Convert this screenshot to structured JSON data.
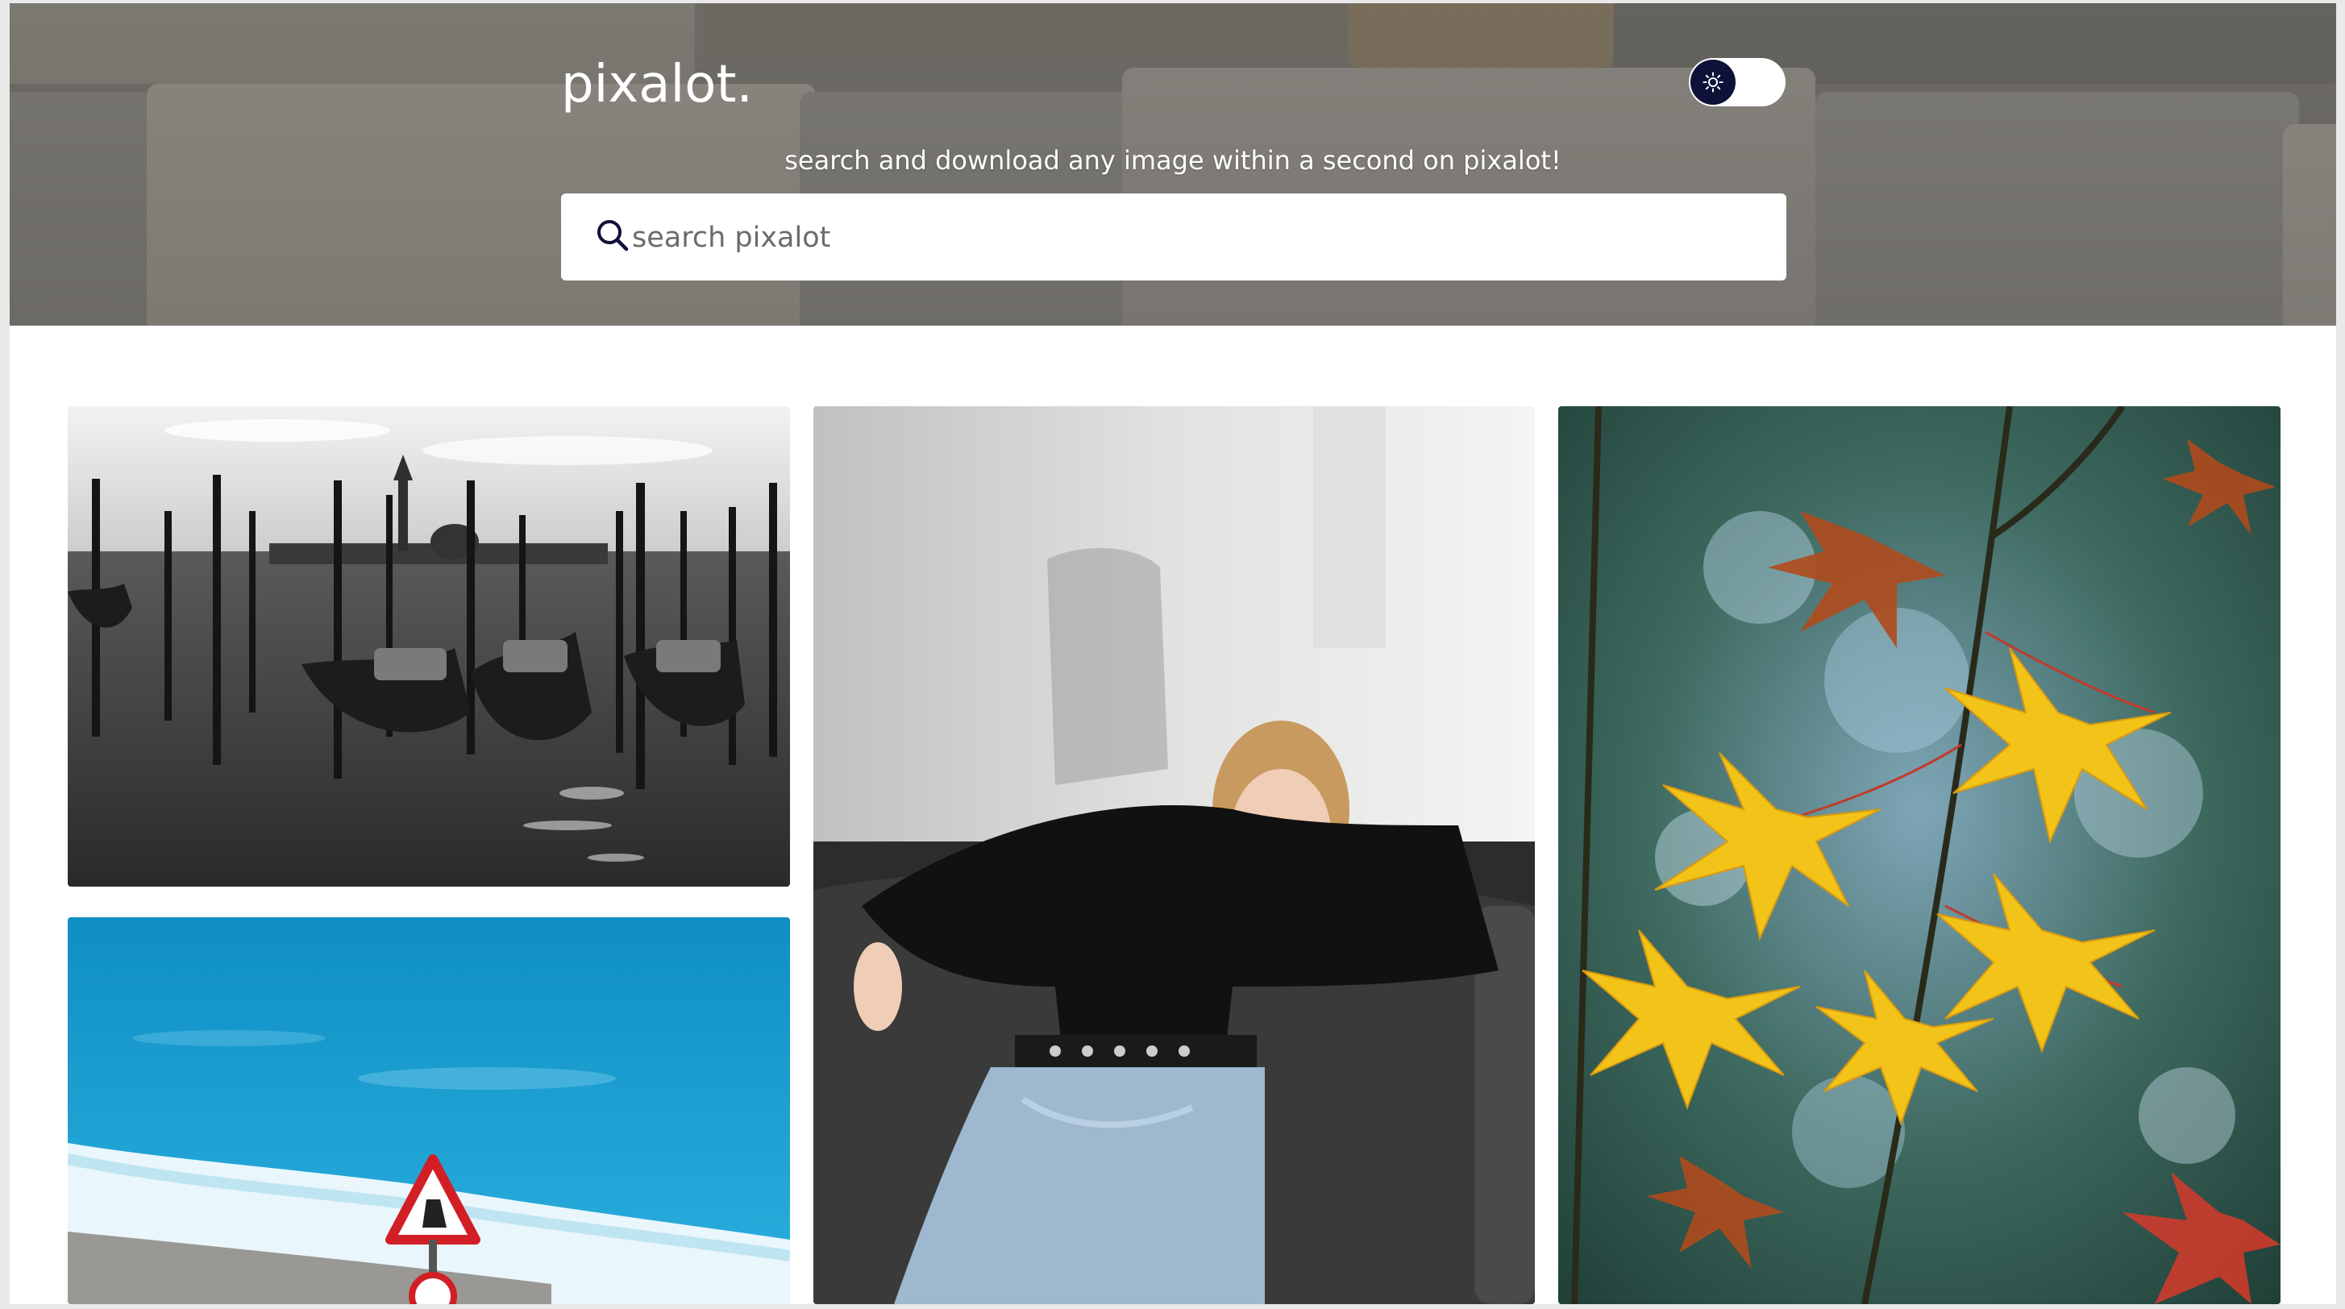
{
  "header": {
    "logo": "pixalot.",
    "tagline": "search and download any image within a second on pixalot!",
    "theme_toggle_icon": "sun-icon"
  },
  "search": {
    "placeholder": "search pixalot",
    "value": "",
    "icon": "search-icon"
  },
  "colors": {
    "toggle_knob": "#0e1138",
    "page_background": "#ffffff",
    "search_background": "#ffffff"
  },
  "gallery": {
    "images": [
      {
        "subject": "black and white gondolas in venice"
      },
      {
        "subject": "woman in black top leaning on grey sofa"
      },
      {
        "subject": "yellow maple leaves on branch"
      },
      {
        "subject": "blue sea with warning sign on beach"
      }
    ]
  }
}
